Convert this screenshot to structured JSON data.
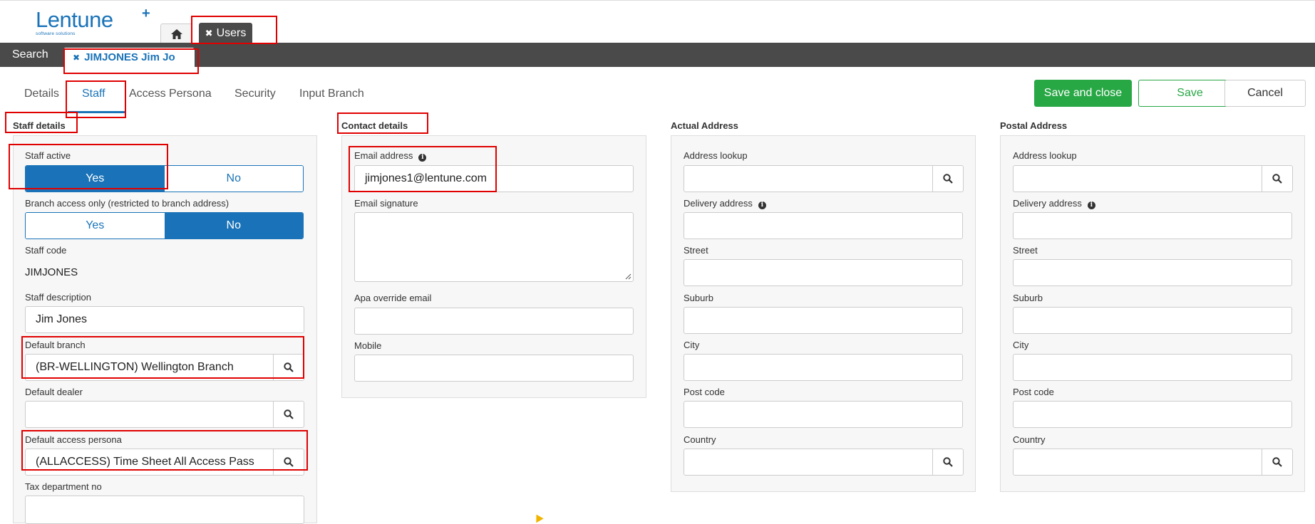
{
  "app": {
    "logo_text": "Lentune",
    "logo_plus": "+",
    "logo_tagline": "software solutions",
    "accent_color": "#1a73b8",
    "success_color": "#28a745"
  },
  "top_tabs": {
    "home_icon": "home-icon",
    "users_label": "Users"
  },
  "subbar": {
    "search_label": "Search",
    "record_tab_label": "JIMJONES Jim Jo"
  },
  "inner_tabs": [
    {
      "label": "Details"
    },
    {
      "label": "Staff"
    },
    {
      "label": "Access Persona"
    },
    {
      "label": "Security"
    },
    {
      "label": "Input Branch"
    }
  ],
  "actions": {
    "save_and_close": "Save and close",
    "save": "Save",
    "cancel": "Cancel"
  },
  "staff_details": {
    "title": "Staff details",
    "staff_active": {
      "label": "Staff active",
      "yes": "Yes",
      "no": "No",
      "selected": "Yes"
    },
    "branch_access": {
      "label": "Branch access only (restricted to branch address)",
      "yes": "Yes",
      "no": "No",
      "selected": "No"
    },
    "staff_code": {
      "label": "Staff code",
      "value": "JIMJONES"
    },
    "staff_description": {
      "label": "Staff description",
      "value": "Jim Jones"
    },
    "default_branch": {
      "label": "Default branch",
      "value": "(BR-WELLINGTON) Wellington Branch"
    },
    "default_dealer": {
      "label": "Default dealer",
      "value": ""
    },
    "default_access_persona": {
      "label": "Default access persona",
      "value": "(ALLACCESS) Time Sheet All Access Pass"
    },
    "tax_department_no": {
      "label": "Tax department no",
      "value": ""
    }
  },
  "contact_details": {
    "title": "Contact details",
    "email_address": {
      "label": "Email address",
      "value": "jimjones1@lentune.com"
    },
    "email_signature": {
      "label": "Email signature",
      "value": ""
    },
    "apa_override_email": {
      "label": "Apa override email",
      "value": ""
    },
    "mobile": {
      "label": "Mobile",
      "value": ""
    }
  },
  "actual_address": {
    "title": "Actual Address",
    "address_lookup": "Address lookup",
    "delivery_address": "Delivery address",
    "street": "Street",
    "suburb": "Suburb",
    "city": "City",
    "post_code": "Post code",
    "country": "Country"
  },
  "postal_address": {
    "title": "Postal Address",
    "address_lookup": "Address lookup",
    "delivery_address": "Delivery address",
    "street": "Street",
    "suburb": "Suburb",
    "city": "City",
    "post_code": "Post code",
    "country": "Country"
  }
}
